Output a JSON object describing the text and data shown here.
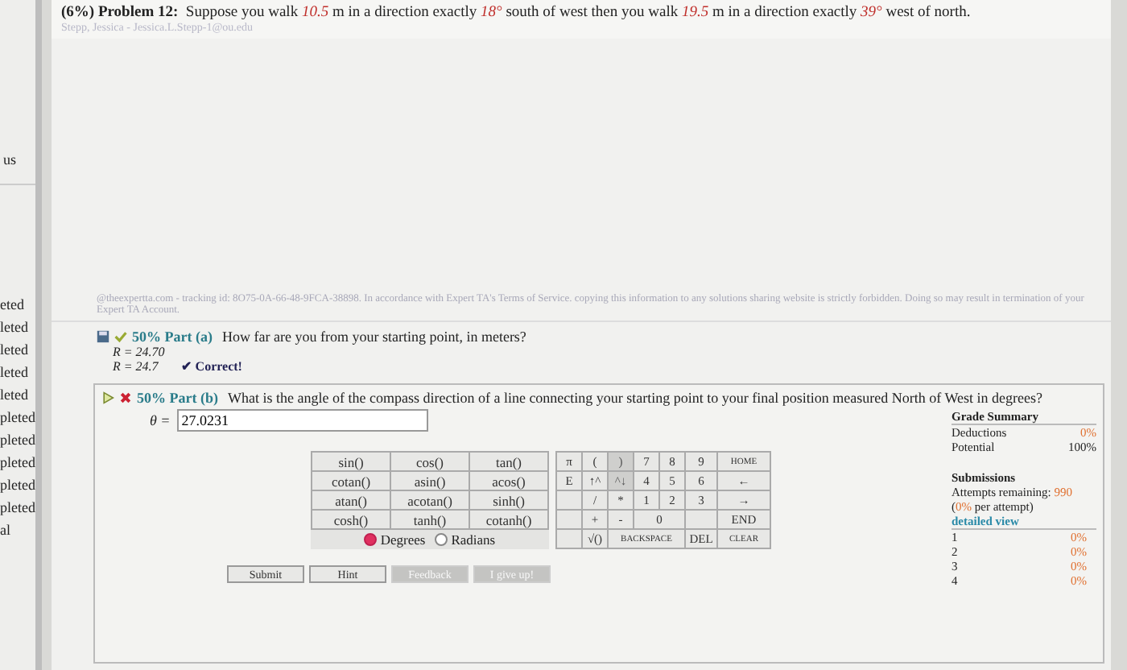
{
  "sidebar": {
    "heading": "us",
    "items": [
      "eted",
      "leted",
      "leted",
      "leted",
      "leted",
      "pleted",
      "pleted",
      "pleted",
      "pleted",
      "pleted",
      "al"
    ]
  },
  "problem": {
    "label": "(6%) Problem 12:",
    "statement": [
      {
        "kind": "plain",
        "text": "Suppose you walk "
      },
      {
        "kind": "value",
        "text": "10.5"
      },
      {
        "kind": "plain",
        "text": " m in a direction exactly "
      },
      {
        "kind": "value",
        "text": "18°"
      },
      {
        "kind": "plain",
        "text": " south of west then you walk "
      },
      {
        "kind": "value",
        "text": "19.5"
      },
      {
        "kind": "plain",
        "text": " m in a direction exactly "
      },
      {
        "kind": "value",
        "text": "39°"
      },
      {
        "kind": "plain",
        "text": " west of north."
      }
    ],
    "student": "Stepp, Jessica - Jessica.L.Stepp-1@ou.edu"
  },
  "notice": "@theexpertta.com - tracking id: 8O75-0A-66-48-9FCA-38898. In accordance with Expert TA's Terms of Service. copying this information to any solutions sharing website is strictly forbidden. Doing so may result in termination of your Expert TA Account.",
  "part_a": {
    "label": "50% Part (a)",
    "question": "How far are you from your starting point, in meters?",
    "answers": [
      "R = 24.70",
      "R = 24.7"
    ],
    "status_mark": "✔",
    "status": "Correct!"
  },
  "part_b": {
    "label": "50% Part (b)",
    "question": "What is the angle of the compass direction of a line connecting your starting point to your final position measured North of West in degrees?",
    "variable": "θ =",
    "value": "27.0231",
    "functions": [
      [
        "sin()",
        "cos()",
        "tan()"
      ],
      [
        "cotan()",
        "asin()",
        "acos()"
      ],
      [
        "atan()",
        "acotan()",
        "sinh()"
      ],
      [
        "cosh()",
        "tanh()",
        "cotanh()"
      ]
    ],
    "angle_modes": [
      {
        "label": "Degrees",
        "selected": true
      },
      {
        "label": "Radians",
        "selected": false
      }
    ],
    "keypad": [
      [
        {
          "kind": "key",
          "label": "π"
        },
        {
          "kind": "key",
          "label": "("
        },
        {
          "kind": "disabled",
          "label": ")"
        },
        {
          "kind": "key",
          "label": "7"
        },
        {
          "kind": "key",
          "label": "8"
        },
        {
          "kind": "key",
          "label": "9"
        },
        {
          "kind": "key",
          "label": "HOME"
        }
      ],
      [
        {
          "kind": "key",
          "label": "E"
        },
        {
          "kind": "key",
          "label": "↑^"
        },
        {
          "kind": "disabled",
          "label": "^↓"
        },
        {
          "kind": "key",
          "label": "4"
        },
        {
          "kind": "key",
          "label": "5"
        },
        {
          "kind": "key",
          "label": "6"
        },
        {
          "kind": "key",
          "label": "←"
        }
      ],
      [
        {
          "kind": "blank"
        },
        {
          "kind": "key",
          "label": "/"
        },
        {
          "kind": "key",
          "label": "*"
        },
        {
          "kind": "key",
          "label": "1"
        },
        {
          "kind": "key",
          "label": "2"
        },
        {
          "kind": "key",
          "label": "3"
        },
        {
          "kind": "key",
          "label": "→"
        }
      ],
      [
        {
          "kind": "blank"
        },
        {
          "kind": "key",
          "label": "+"
        },
        {
          "kind": "key",
          "label": "-"
        },
        {
          "kind": "double",
          "label": "0"
        },
        {
          "kind": "blank"
        },
        {
          "kind": "key",
          "label": "END"
        }
      ],
      [
        {
          "kind": "blank"
        },
        {
          "kind": "key",
          "label": "√()"
        },
        {
          "kind": "triple",
          "label": "BACKSPACE"
        },
        {
          "kind": "key",
          "label": "DEL"
        },
        {
          "kind": "key",
          "label": "CLEAR"
        }
      ]
    ],
    "buttons": [
      {
        "label": "Submit",
        "disabled": false
      },
      {
        "label": "Hint",
        "disabled": false
      },
      {
        "label": "Feedback",
        "disabled": true
      },
      {
        "label": "I give up!",
        "disabled": true
      }
    ],
    "grade_summary": {
      "title": "Grade Summary",
      "rows": [
        {
          "label": "Deductions",
          "value": "0%"
        },
        {
          "label": "Potential",
          "value": "100%"
        }
      ]
    },
    "submissions": {
      "title": "Submissions",
      "attempts_label": "Attempts remaining:",
      "attempts": "990",
      "per_attempt_open": "(",
      "per_attempt_value": "0%",
      "per_attempt_text": "per attempt)",
      "link": "detailed view",
      "rows": [
        {
          "number": "1",
          "value": "0%"
        },
        {
          "number": "2",
          "value": "0%"
        },
        {
          "number": "3",
          "value": "0%"
        },
        {
          "number": "4",
          "value": "0%"
        }
      ]
    }
  }
}
